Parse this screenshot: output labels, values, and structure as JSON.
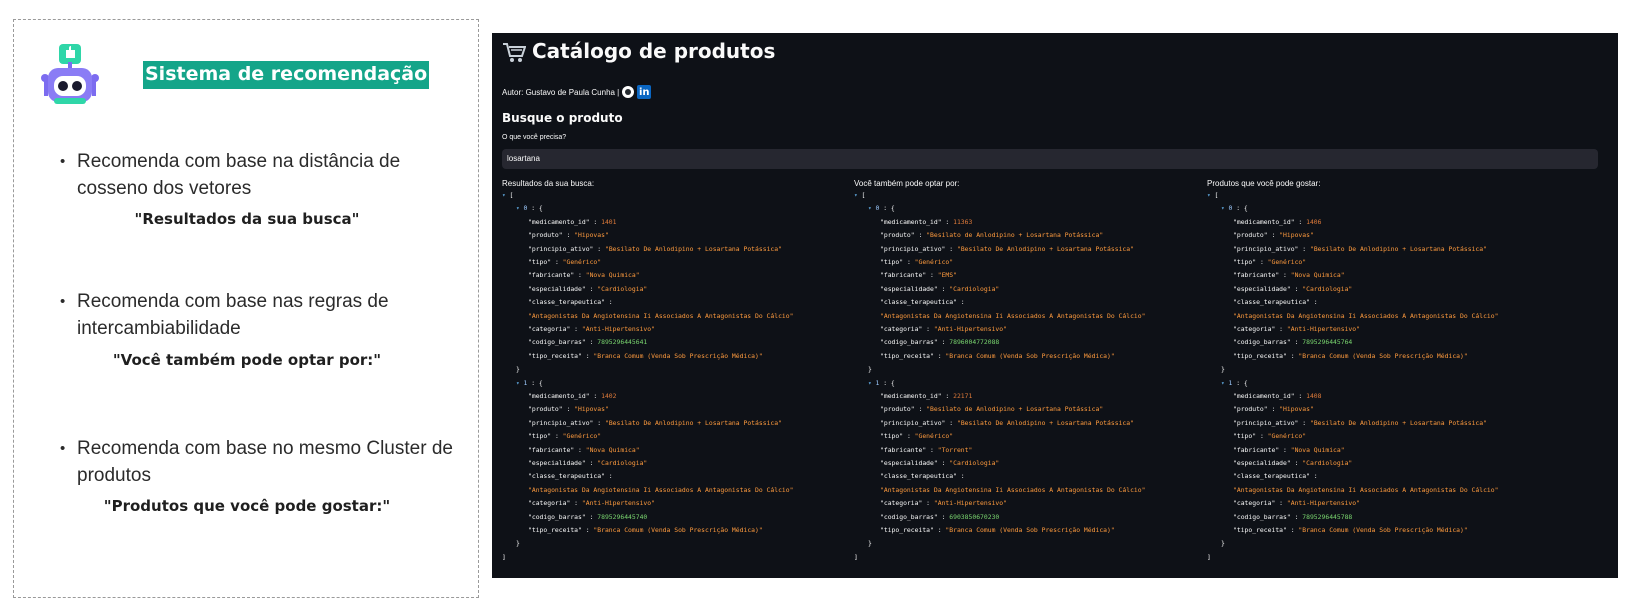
{
  "left": {
    "title": "Sistema de recomendação",
    "bullets": [
      {
        "text": "Recomenda com base na distância de cosseno dos vetores",
        "quote": "\"Resultados da sua busca\""
      },
      {
        "text": "Recomenda com base nas regras de intercambiabilidade",
        "quote": "\"Você também pode optar por:\""
      },
      {
        "text": "Recomenda com base no mesmo Cluster de produtos",
        "quote": "\"Produtos que você pode gostar:\""
      }
    ],
    "bullet_glyph": "•",
    "robot_icon": "robot-icon",
    "accent": "#14a589"
  },
  "app": {
    "title": "Catálogo de produtos",
    "author": "Autor: Gustavo de Paula Cunha |",
    "section": "Busque o produto",
    "input_label": "O que você precisa?",
    "search_value": "losartana",
    "background": "#0e1117",
    "columns": [
      {
        "label": "Resultados da sua busca:",
        "items": [
          {
            "medicamento_id": "1401",
            "produto": "\"Hipovas\"",
            "principio_ativo": "\"Besilato De Anlodipino + Losartana Potássica\"",
            "tipo": "\"Genérico\"",
            "fabricante": "\"Nova Quimica\"",
            "especialidade": "\"Cardiologia\"",
            "classe_terapeutica": "\"Antagonistas Da Angiotensina Ii Associados A Antagonistas Do Cálcio\"",
            "categoria": "\"Anti-Hipertensivo\"",
            "codigo_barras": "7895296445641",
            "tipo_receita": "\"Branca Comum (Venda Sob Prescrição Médica)\""
          },
          {
            "medicamento_id": "1402",
            "produto": "\"Hipovas\"",
            "principio_ativo": "\"Besilato De Anlodipino + Losartana Potássica\"",
            "tipo": "\"Genérico\"",
            "fabricante": "\"Nova Quimica\"",
            "especialidade": "\"Cardiologia\"",
            "classe_terapeutica": "\"Antagonistas Da Angiotensina Ii Associados A Antagonistas Do Cálcio\"",
            "categoria": "\"Anti-Hipertensivo\"",
            "codigo_barras": "7895296445740",
            "tipo_receita": "\"Branca Comum (Venda Sob Prescrição Médica)\""
          }
        ]
      },
      {
        "label": "Você também pode optar por:",
        "items": [
          {
            "medicamento_id": "11363",
            "produto": "\"Besilato de Anlodipino + Losartana Potássica\"",
            "principio_ativo": "\"Besilato De Anlodipino + Losartana Potássica\"",
            "tipo": "\"Genérico\"",
            "fabricante": "\"EMS\"",
            "especialidade": "\"Cardiologia\"",
            "classe_terapeutica": "\"Antagonistas Da Angiotensina Ii Associados A Antagonistas Do Cálcio\"",
            "categoria": "\"Anti-Hipertensivo\"",
            "codigo_barras": "7896004772088",
            "tipo_receita": "\"Branca Comum (Venda Sob Prescrição Médica)\""
          },
          {
            "medicamento_id": "22171",
            "produto": "\"Besilato de Anlodipino + Losartana Potássica\"",
            "principio_ativo": "\"Besilato De Anlodipino + Losartana Potássica\"",
            "tipo": "\"Genérico\"",
            "fabricante": "\"Torrent\"",
            "especialidade": "\"Cardiologia\"",
            "classe_terapeutica": "\"Antagonistas Da Angiotensina Ii Associados A Antagonistas Do Cálcio\"",
            "categoria": "\"Anti-Hipertensivo\"",
            "codigo_barras": "6903850670230",
            "tipo_receita": "\"Branca Comum (Venda Sob Prescrição Médica)\""
          }
        ]
      },
      {
        "label": "Produtos que você pode gostar:",
        "items": [
          {
            "medicamento_id": "1406",
            "produto": "\"Hipovas\"",
            "principio_ativo": "\"Besilato De Anlodipino + Losartana Potássica\"",
            "tipo": "\"Genérico\"",
            "fabricante": "\"Nova Quimica\"",
            "especialidade": "\"Cardiologia\"",
            "classe_terapeutica": "\"Antagonistas Da Angiotensina Ii Associados A Antagonistas Do Cálcio\"",
            "categoria": "\"Anti-Hipertensivo\"",
            "codigo_barras": "7895296445764",
            "tipo_receita": "\"Branca Comum (Venda Sob Prescrição Médica)\""
          },
          {
            "medicamento_id": "1408",
            "produto": "\"Hipovas\"",
            "principio_ativo": "\"Besilato De Anlodipino + Losartana Potássica\"",
            "tipo": "\"Genérico\"",
            "fabricante": "\"Nova Quimica\"",
            "especialidade": "\"Cardiologia\"",
            "classe_terapeutica": "\"Antagonistas Da Angiotensina Ii Associados A Antagonistas Do Cálcio\"",
            "categoria": "\"Anti-Hipertensivo\"",
            "codigo_barras": "7895296445788",
            "tipo_receita": "\"Branca Comum (Venda Sob Prescrição Médica)\""
          }
        ]
      }
    ]
  }
}
